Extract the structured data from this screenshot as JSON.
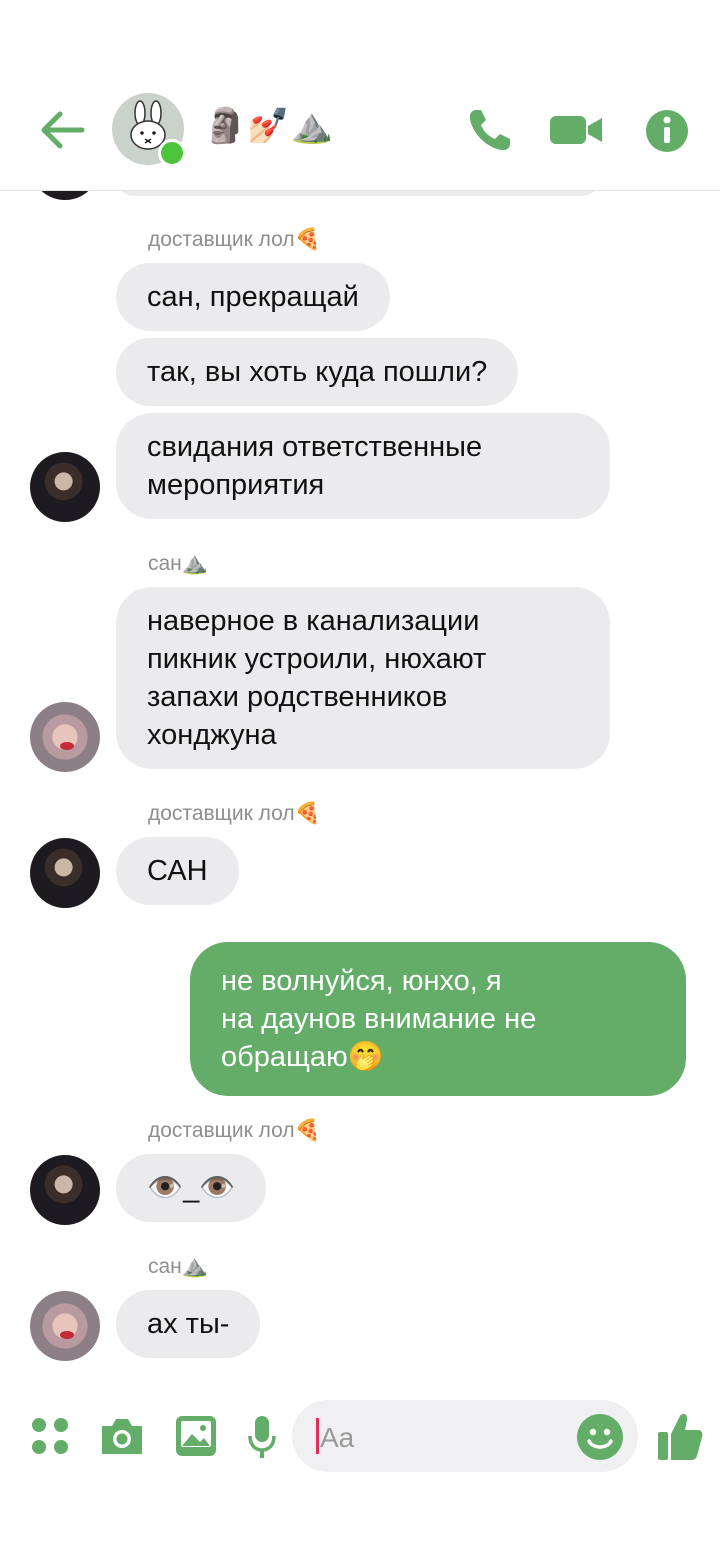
{
  "header": {
    "title": "🗿💅🏻⛰️",
    "avatar_icon": "miffy-bunny-icon",
    "status": "online",
    "accent_color": "#63ad69"
  },
  "messages": [
    {
      "sender": "доставщик лол🍕"
    },
    {
      "text": "сан, прекращай"
    },
    {
      "text": "так, вы хоть куда пошли?"
    },
    {
      "text": "свидания ответственные\nмероприятия"
    },
    {
      "sender": "сан⛰️"
    },
    {
      "text": "наверное в канализации\nпикник устроили, нюхают\nзапахи родственников\nхонджуна"
    },
    {
      "sender": "доставщик лол🍕"
    },
    {
      "text": "САН"
    },
    {
      "text": "не волнуйся, юнхо, я\nна даунов внимание не\nобращаю🤭"
    },
    {
      "sender": "доставщик лол🍕"
    },
    {
      "text": "👁️_👁️"
    },
    {
      "sender": "сан⛰️"
    },
    {
      "text": "ах ты-"
    }
  ],
  "composer": {
    "placeholder": "Aa"
  }
}
